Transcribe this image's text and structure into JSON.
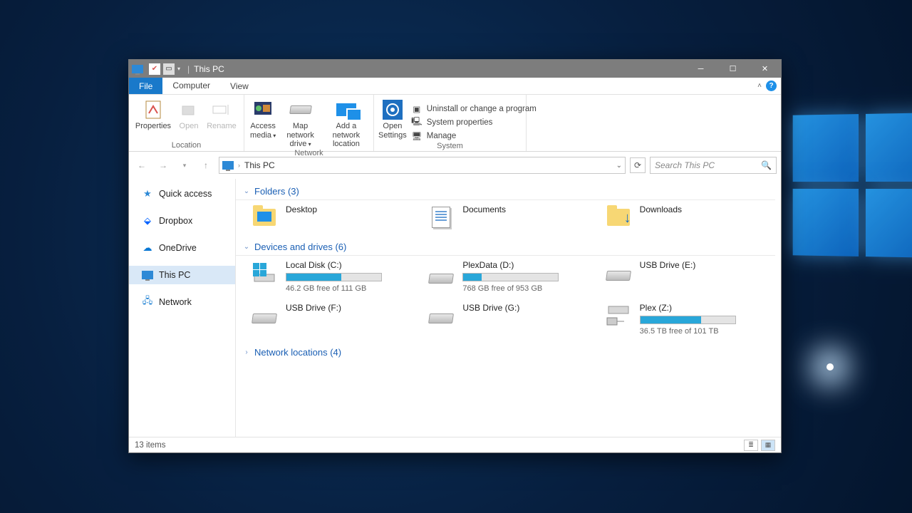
{
  "titlebar": {
    "title": "This PC"
  },
  "ribbon_tabs": {
    "file": "File",
    "computer": "Computer",
    "view": "View"
  },
  "ribbon": {
    "location": {
      "label": "Location",
      "properties": "Properties",
      "open": "Open",
      "rename": "Rename"
    },
    "network": {
      "label": "Network",
      "access_media": "Access media",
      "map_drive": "Map network drive",
      "add_location": "Add a network location"
    },
    "system": {
      "label": "System",
      "open_settings": "Open Settings",
      "uninstall": "Uninstall or change a program",
      "system_props": "System properties",
      "manage": "Manage"
    }
  },
  "address": {
    "crumb": "This PC"
  },
  "search": {
    "placeholder": "Search This PC"
  },
  "sidebar": {
    "quick_access": "Quick access",
    "dropbox": "Dropbox",
    "onedrive": "OneDrive",
    "this_pc": "This PC",
    "network": "Network"
  },
  "groups": {
    "folders": {
      "label": "Folders (3)"
    },
    "drives": {
      "label": "Devices and drives (6)"
    },
    "netloc": {
      "label": "Network locations (4)"
    }
  },
  "folders": {
    "desktop": "Desktop",
    "documents": "Documents",
    "downloads": "Downloads"
  },
  "drives": {
    "c": {
      "name": "Local Disk (C:)",
      "free": "46.2 GB free of 111 GB",
      "pct": 58
    },
    "d": {
      "name": "PlexData (D:)",
      "free": "768 GB free of 953 GB",
      "pct": 19
    },
    "e": {
      "name": "USB Drive (E:)"
    },
    "f": {
      "name": "USB Drive (F:)"
    },
    "g": {
      "name": "USB Drive (G:)"
    },
    "z": {
      "name": "Plex (Z:)",
      "free": "36.5 TB free of 101 TB",
      "pct": 64
    }
  },
  "status": {
    "items": "13 items"
  }
}
